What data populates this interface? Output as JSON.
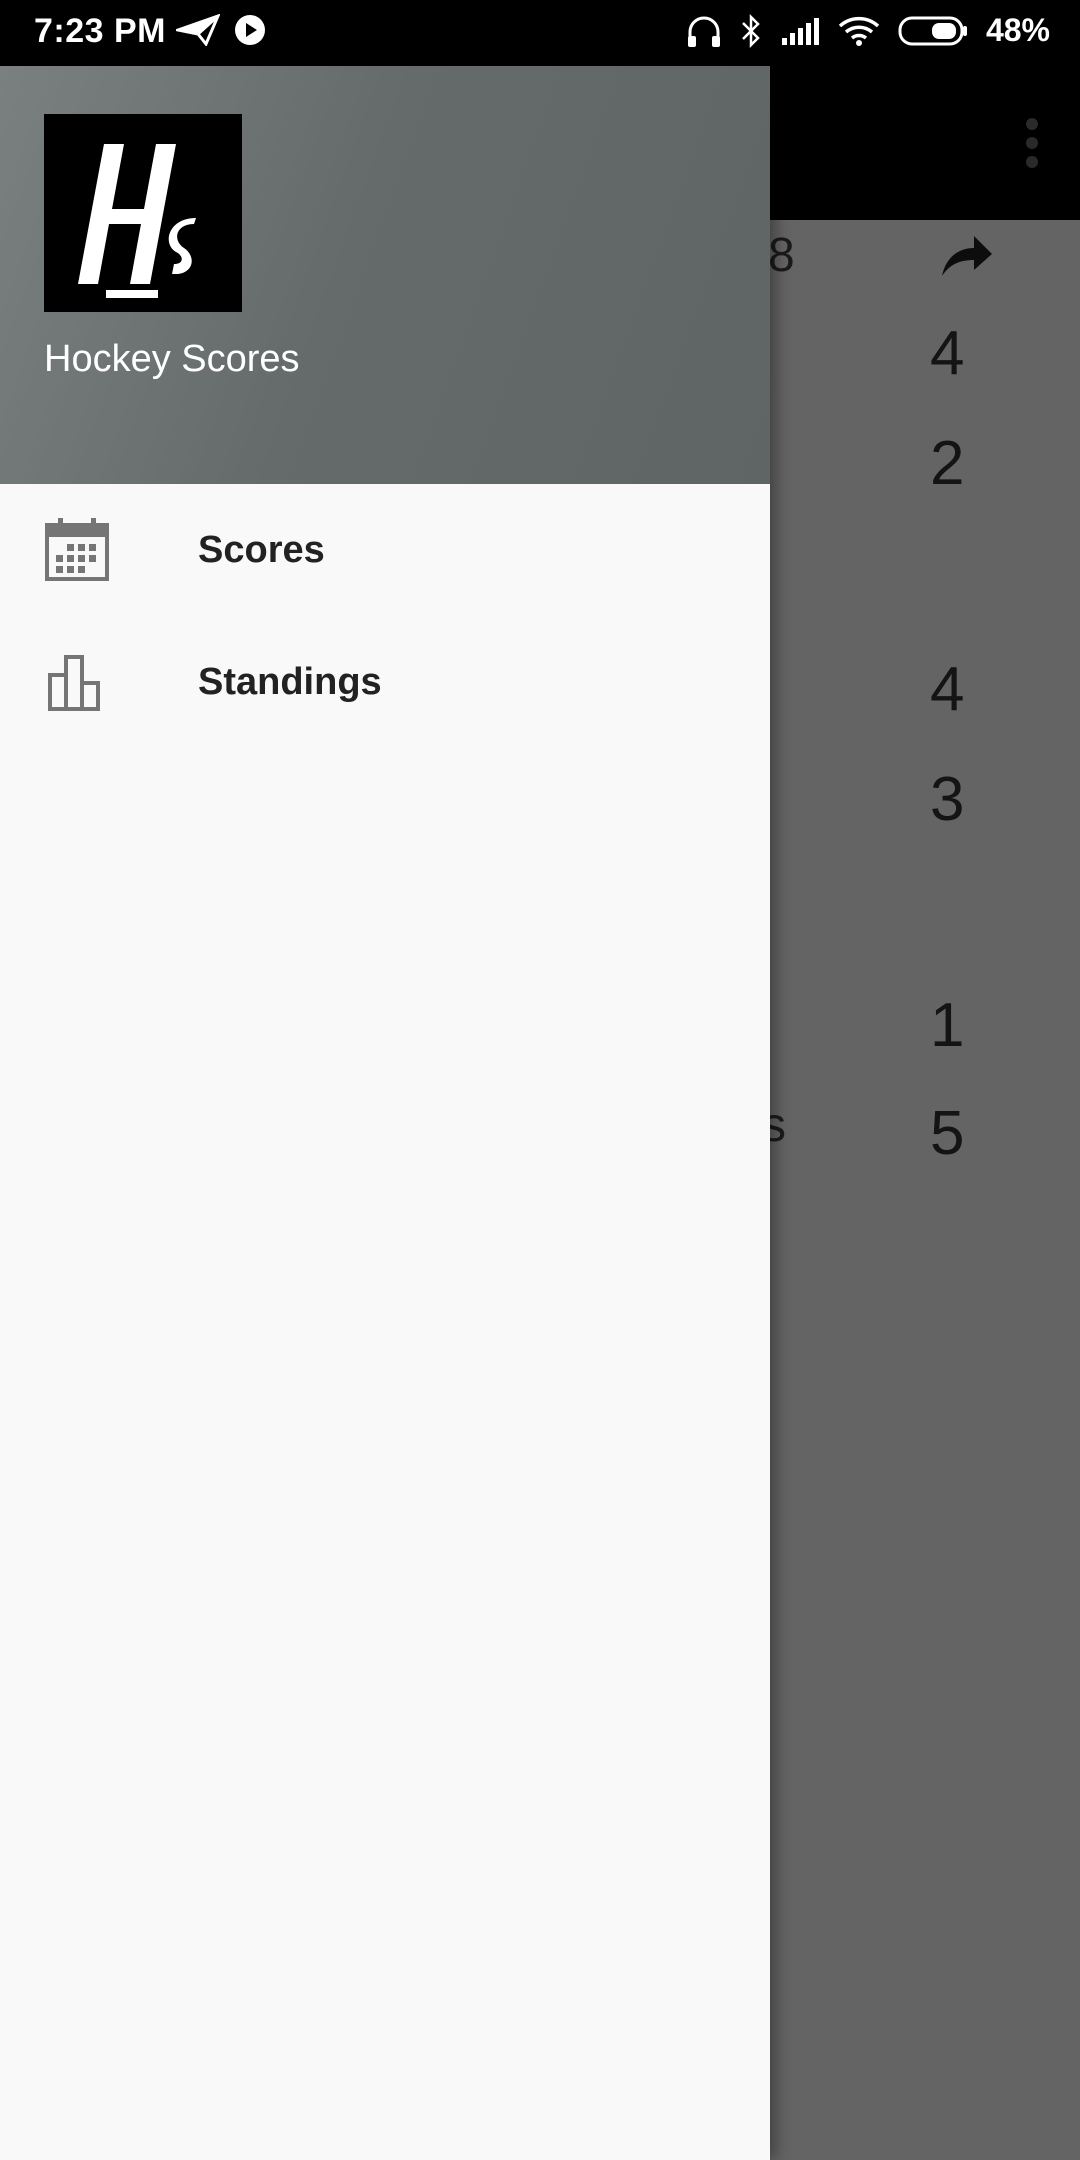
{
  "status_bar": {
    "time": "7:23 PM",
    "battery_percent": "48%",
    "icons": [
      "send-icon",
      "play-circle-icon",
      "headphones-icon",
      "bluetooth-icon",
      "cell-signal-icon",
      "wifi-icon",
      "battery-icon"
    ]
  },
  "app": {
    "overflow_icon": "more-vert-icon",
    "share_icon": "share-icon",
    "peek": {
      "date_fragment": "8",
      "scores": [
        "4",
        "2",
        "4",
        "3",
        "1",
        "5"
      ],
      "name_fragment": "s"
    }
  },
  "drawer": {
    "logo_text": "Hs",
    "app_name": "Hockey Scores",
    "items": [
      {
        "label": "Scores",
        "icon": "calendar-icon"
      },
      {
        "label": "Standings",
        "icon": "bar-chart-icon"
      }
    ]
  }
}
